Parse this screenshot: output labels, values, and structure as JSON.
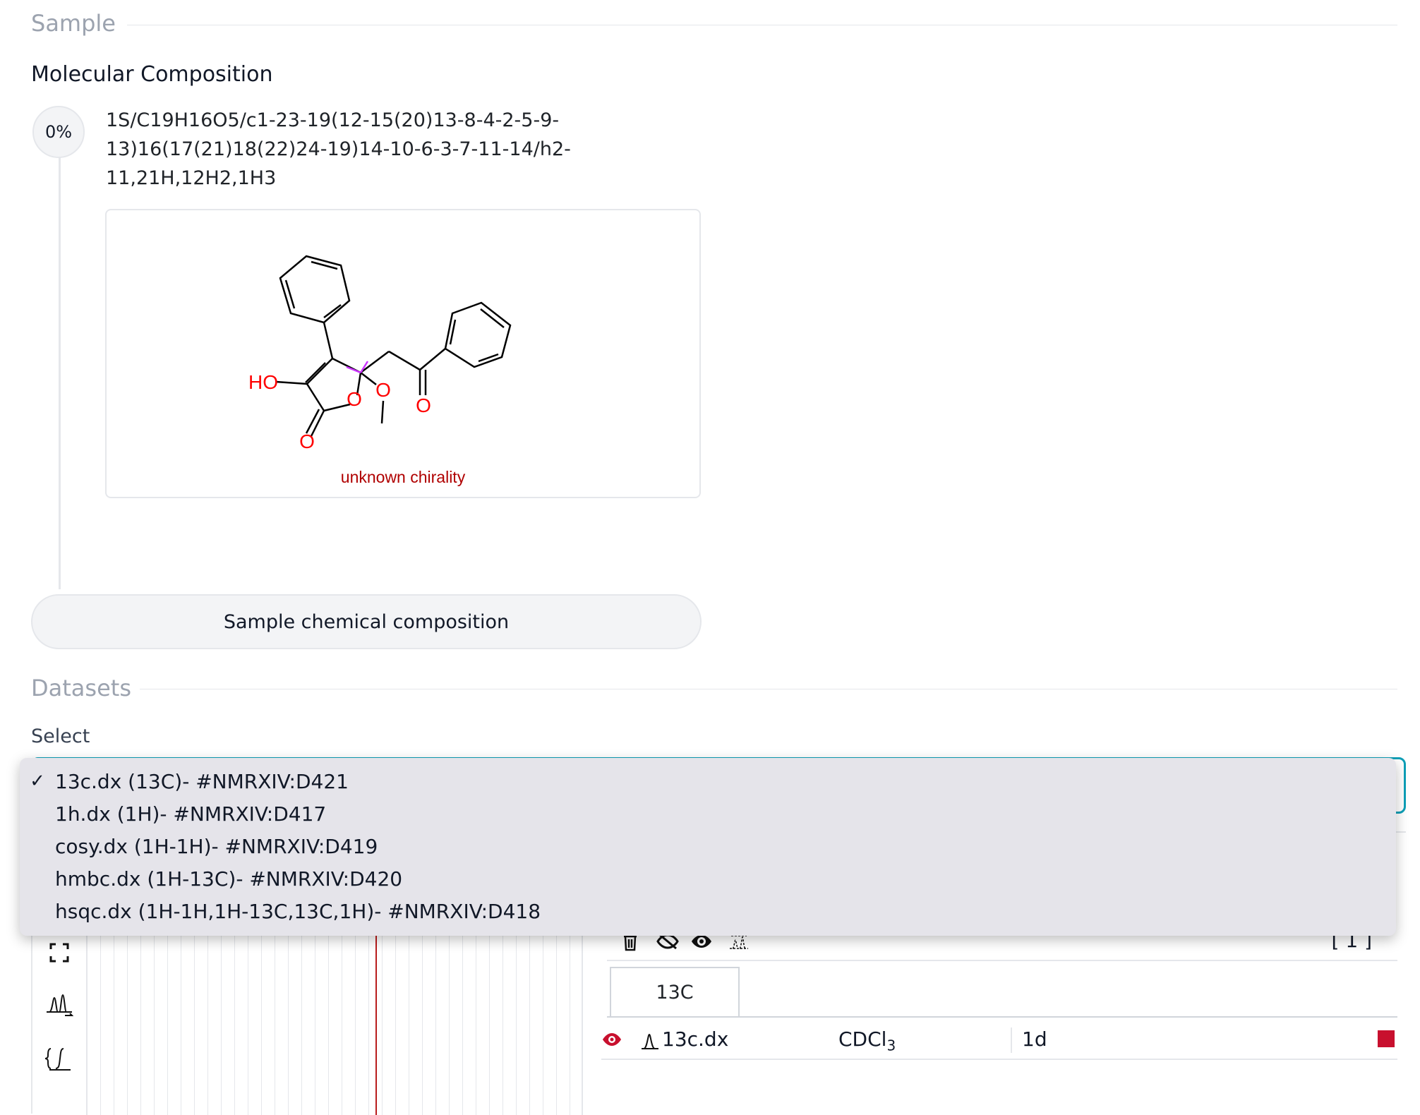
{
  "sample": {
    "section_title": "Sample",
    "molecular_composition_title": "Molecular Composition",
    "percent_badge": "0%",
    "inchi_lines": [
      "1S/C19H16O5/c1-23-19(12-15(20)13-8-4-2-5-9-",
      "13)16(17(21)18(22)24-19)14-10-6-3-7-11-14/h2-",
      "11,21H,12H2,1H3"
    ],
    "structure_labels": {
      "ho": "HO",
      "o1": "O",
      "o2": "O",
      "o3": "O",
      "o4": "O"
    },
    "chirality_note": "unknown chirality",
    "composition_button": "Sample chemical composition"
  },
  "datasets": {
    "section_title": "Datasets",
    "select_label": "Select",
    "options": [
      {
        "label": "13c.dx (13C)- #NMRXIV:D421",
        "selected": true
      },
      {
        "label": "1h.dx (1H)- #NMRXIV:D417",
        "selected": false
      },
      {
        "label": "cosy.dx (1H-1H)- #NMRXIV:D419",
        "selected": false
      },
      {
        "label": "hmbc.dx (1H-13C)- #NMRXIV:D420",
        "selected": false
      },
      {
        "label": "hsqc.dx (1H-1H,1H-13C,13C,1H)- #NMRXIV:D418",
        "selected": false
      }
    ],
    "check_mark": "✓"
  },
  "viewer": {
    "counter": "[ 1 ]",
    "tab_label": "13C",
    "spectrum_row": {
      "name": "13c.dx",
      "solvent_main": "CDCl",
      "solvent_sub": "3",
      "dimension": "1d"
    },
    "colors": {
      "accent": "#0e9fb7",
      "cursor_line": "#b91c1c",
      "spectrum_color": "#c8102e",
      "red_label": "#ff0000",
      "chirality_red": "#b00000"
    },
    "icons": [
      "fullscreen-icon",
      "peak-picking-icon",
      "integral-icon",
      "trash-icon",
      "hide-all-icon",
      "show-all-icon",
      "spectra-alignment-icon",
      "visible-eye-icon",
      "spectrum-1d-icon"
    ]
  }
}
